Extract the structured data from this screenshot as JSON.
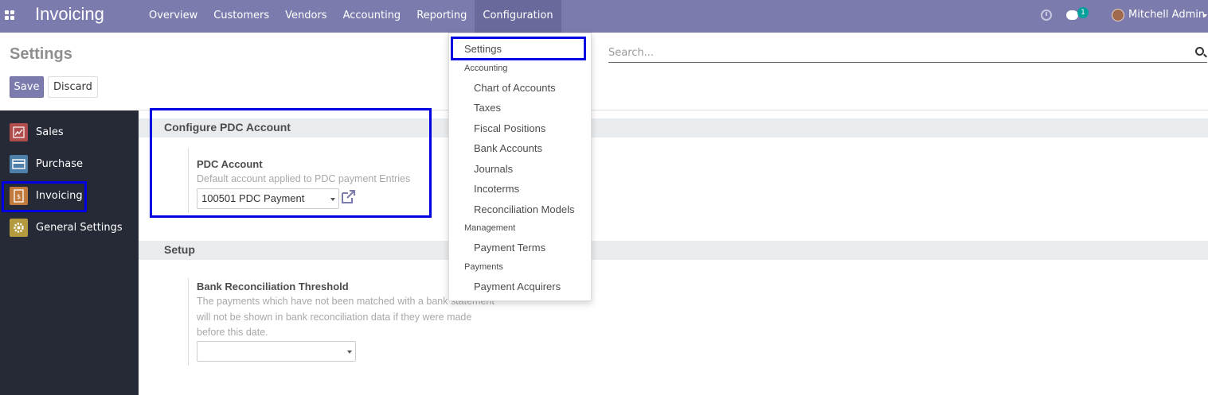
{
  "navbar": {
    "brand": "Invoicing",
    "menu": [
      "Overview",
      "Customers",
      "Vendors",
      "Accounting",
      "Reporting",
      "Configuration"
    ],
    "active_menu": "Configuration",
    "chat_count": "1",
    "user_name": "Mitchell Admin"
  },
  "control_panel": {
    "title": "Settings",
    "save_label": "Save",
    "discard_label": "Discard",
    "search_placeholder": "Search..."
  },
  "sidebar": {
    "items": [
      {
        "label": "Sales",
        "icon": "sales-chart-icon",
        "color": "#b04c4c"
      },
      {
        "label": "Purchase",
        "icon": "purchase-card-icon",
        "color": "#4d7fa9"
      },
      {
        "label": "Invoicing",
        "icon": "invoice-document-icon",
        "color": "#c27b3c"
      },
      {
        "label": "General Settings",
        "icon": "gear-icon",
        "color": "#b39a3e"
      }
    ]
  },
  "sections": {
    "pdc": {
      "title": "Configure PDC Account",
      "label": "PDC Account",
      "help": "Default account applied to PDC payment Entries",
      "value": "100501 PDC Payment"
    },
    "setup": {
      "title": "Setup",
      "label": "Bank Reconciliation Threshold",
      "help_lines": [
        "The payments which have not been matched with a bank statement",
        "will not be shown in bank reconciliation data if they were made",
        "before this date."
      ],
      "value": ""
    }
  },
  "dropdown": {
    "settings": "Settings",
    "accounting_header": "Accounting",
    "accounting_items": [
      "Chart of Accounts",
      "Taxes",
      "Fiscal Positions",
      "Bank Accounts",
      "Journals",
      "Incoterms",
      "Reconciliation Models"
    ],
    "management_header": "Management",
    "management_items": [
      "Payment Terms"
    ],
    "payments_header": "Payments",
    "payments_items": [
      "Payment Acquirers"
    ]
  },
  "colors": {
    "navbar": "#7c7bad",
    "sidebar": "#262a36",
    "highlight": "#0000e0"
  }
}
